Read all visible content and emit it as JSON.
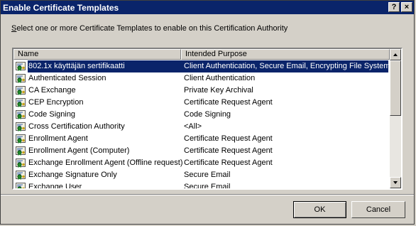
{
  "window": {
    "title": "Enable Certificate Templates",
    "help_label": "?",
    "close_label": "×"
  },
  "instruction": {
    "first_letter": "S",
    "rest": "elect one or more Certificate Templates to enable on this Certification Authority"
  },
  "list": {
    "columns": {
      "name": "Name",
      "purpose": "Intended Purpose"
    },
    "rows": [
      {
        "name": "802.1x käyttäjän sertifikaatti",
        "purpose": "Client Authentication, Secure Email, Encrypting File System",
        "selected": true
      },
      {
        "name": "Authenticated Session",
        "purpose": "Client Authentication"
      },
      {
        "name": "CA Exchange",
        "purpose": "Private Key Archival"
      },
      {
        "name": "CEP Encryption",
        "purpose": "Certificate Request Agent"
      },
      {
        "name": "Code Signing",
        "purpose": "Code Signing"
      },
      {
        "name": "Cross Certification Authority",
        "purpose": "<All>"
      },
      {
        "name": "Enrollment Agent",
        "purpose": "Certificate Request Agent"
      },
      {
        "name": "Enrollment Agent (Computer)",
        "purpose": "Certificate Request Agent"
      },
      {
        "name": "Exchange Enrollment Agent (Offline request)",
        "purpose": "Certificate Request Agent"
      },
      {
        "name": "Exchange Signature Only",
        "purpose": "Secure Email"
      },
      {
        "name": "Exchange User",
        "purpose": "Secure Email"
      }
    ]
  },
  "buttons": {
    "ok": "OK",
    "cancel": "Cancel"
  },
  "icon": "certificate-template-icon",
  "colors": {
    "selection": "#0a246a",
    "titlebar": "#0a246a",
    "face": "#d4d0c8"
  }
}
